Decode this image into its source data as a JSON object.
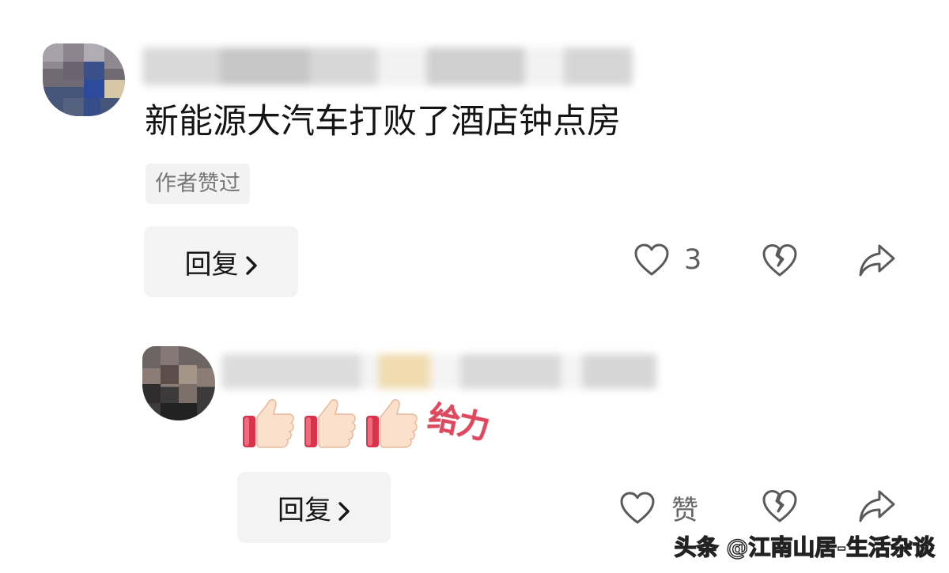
{
  "comments": [
    {
      "text": "新能源大汽车打败了酒店钟点房",
      "badge": "作者赞过",
      "reply_label": "回复",
      "like_count": "3"
    },
    {
      "text_suffix": "给力",
      "reply_label": "回复",
      "like_label": "赞"
    }
  ],
  "watermark": "头条 @江南山居-生活杂谈",
  "icons": {
    "like": "heart-outline-icon",
    "dislike": "broken-heart-icon",
    "share": "share-arrow-icon",
    "chevron": "chevron-right-icon",
    "emoji": "thumbs-up-emoji"
  },
  "colors": {
    "reply_bg": "#f3f3f3",
    "badge_bg": "#f2f2f2",
    "icon_gray": "#666666",
    "geili_red": "#e0485e"
  }
}
